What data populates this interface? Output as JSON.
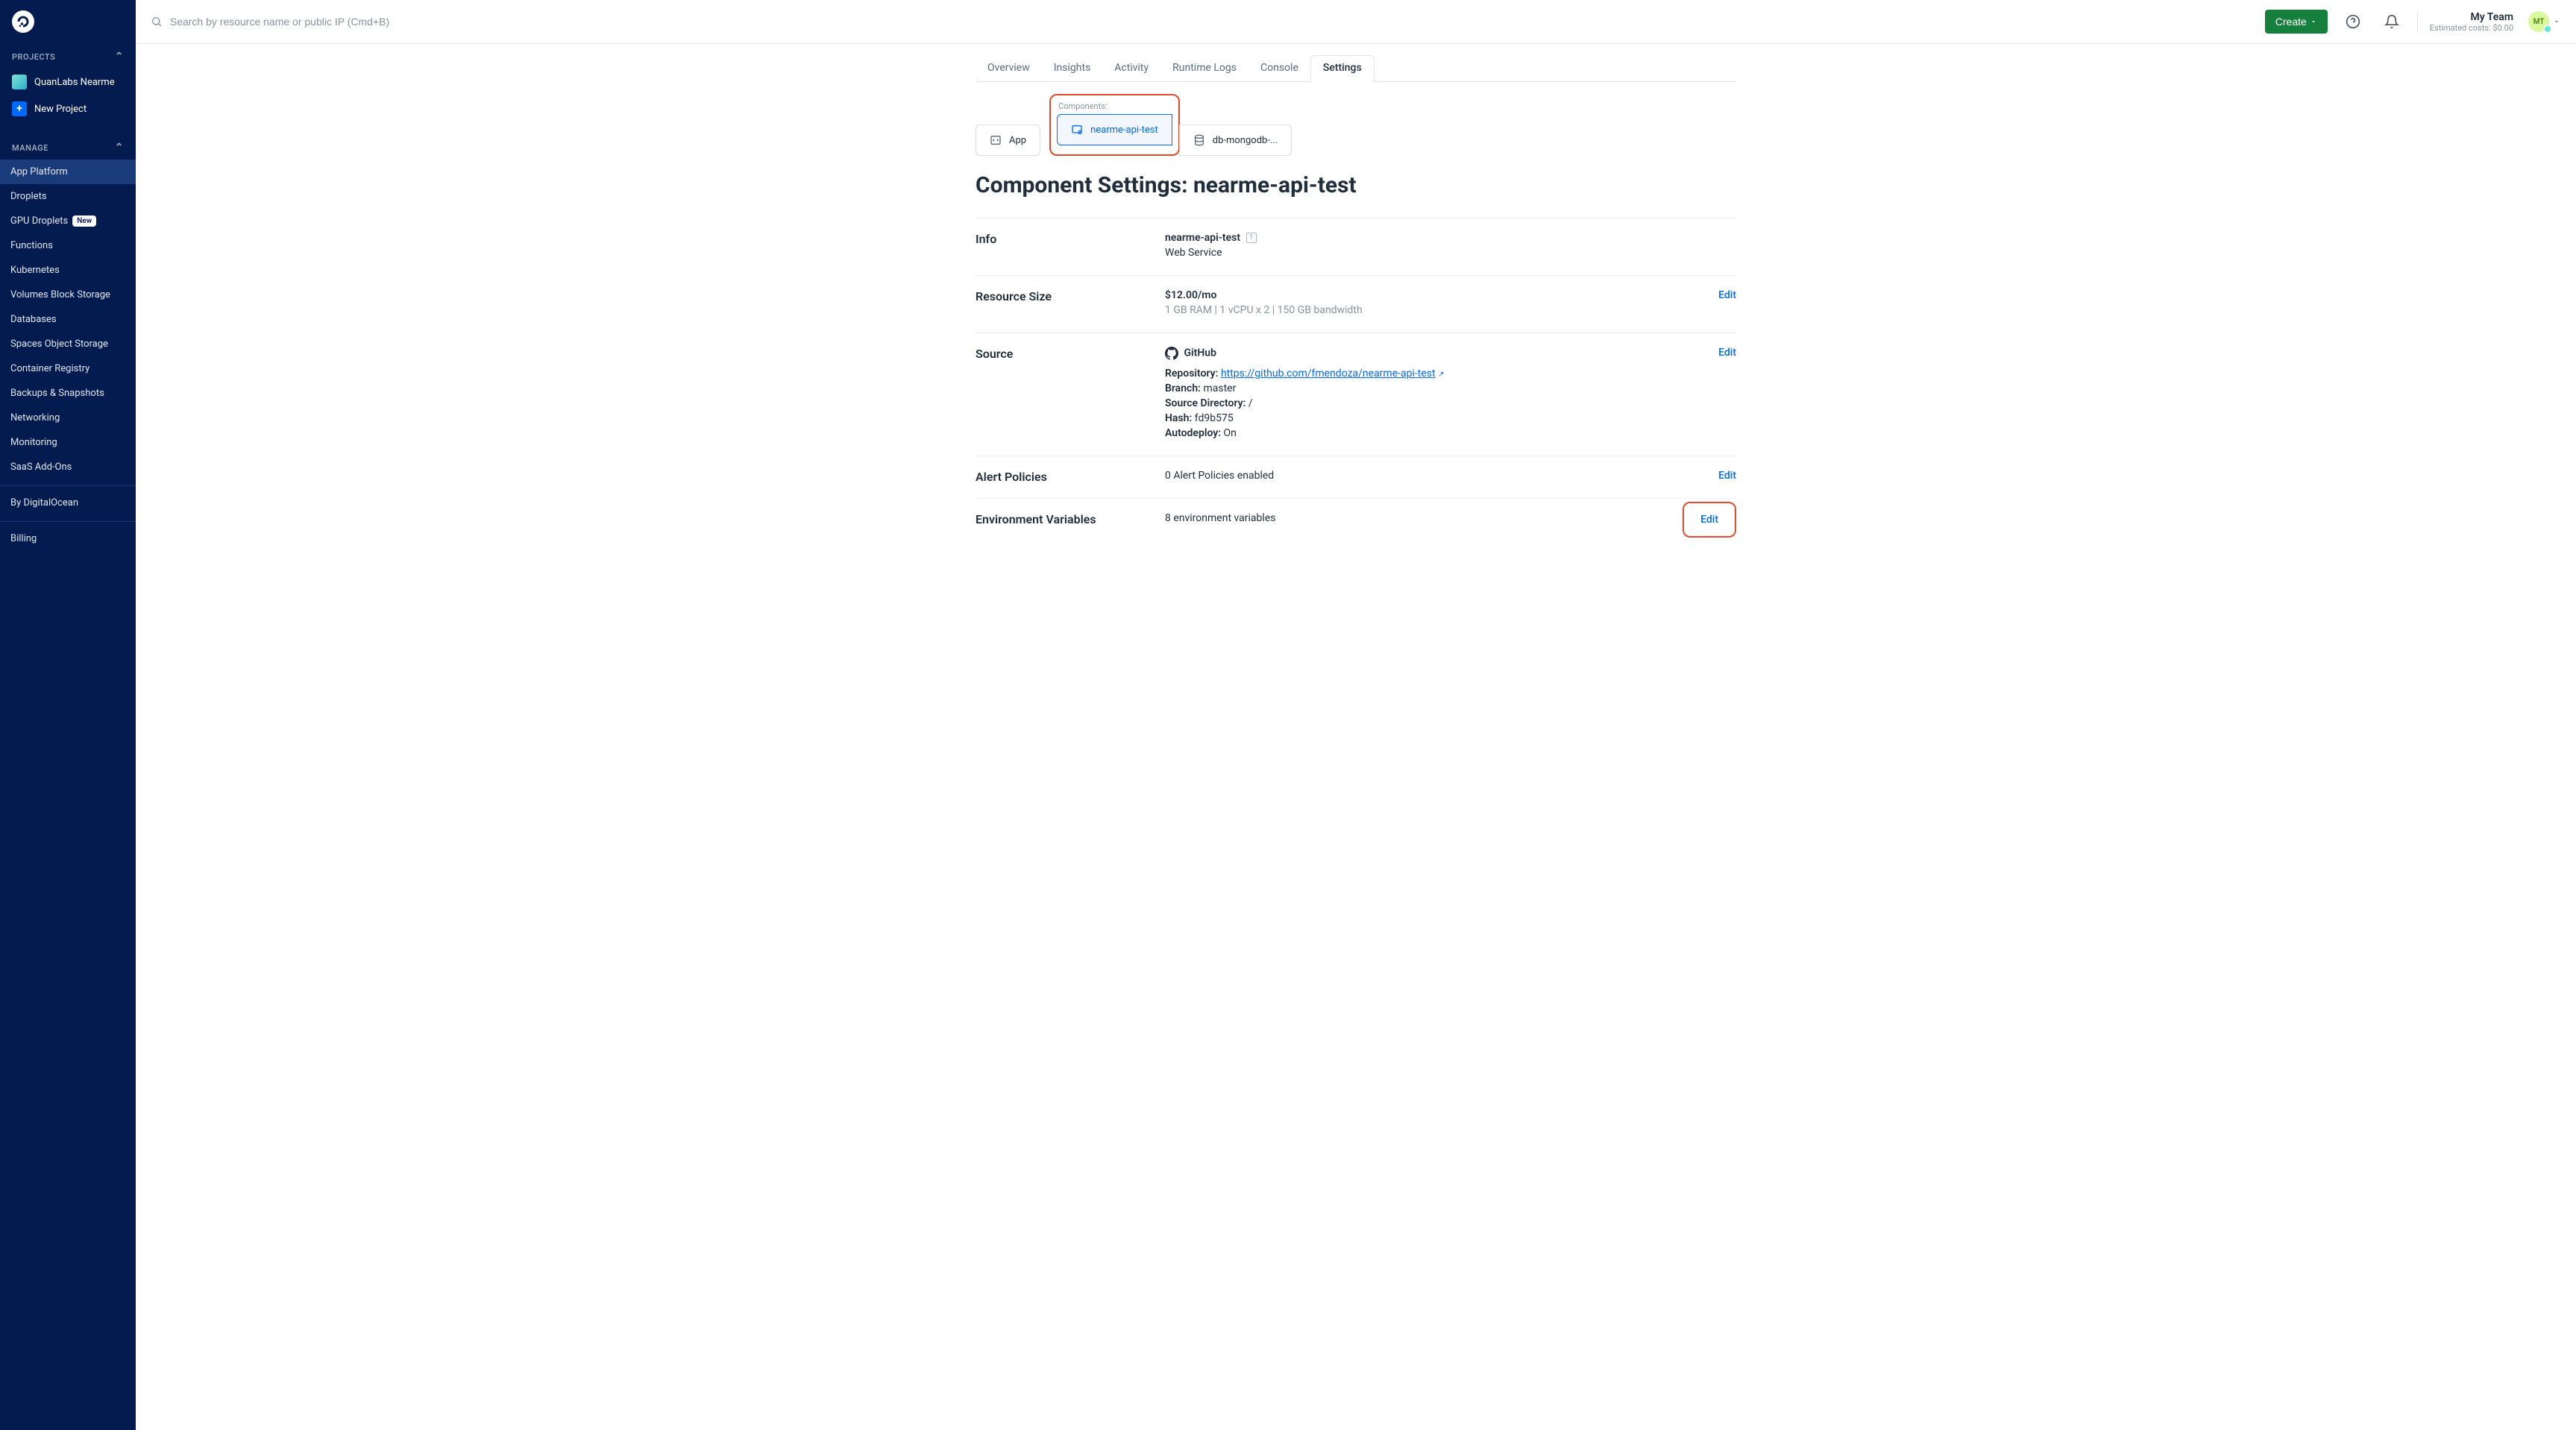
{
  "sidebar": {
    "sections": {
      "projects_label": "PROJECTS",
      "manage_label": "MANAGE"
    },
    "project_name": "QuanLabs Nearme",
    "new_project_label": "New Project",
    "manage_items": [
      {
        "label": "App Platform"
      },
      {
        "label": "Droplets"
      },
      {
        "label": "GPU Droplets",
        "badge": "New"
      },
      {
        "label": "Functions"
      },
      {
        "label": "Kubernetes"
      },
      {
        "label": "Volumes Block Storage"
      },
      {
        "label": "Databases"
      },
      {
        "label": "Spaces Object Storage"
      },
      {
        "label": "Container Registry"
      },
      {
        "label": "Backups & Snapshots"
      },
      {
        "label": "Networking"
      },
      {
        "label": "Monitoring"
      },
      {
        "label": "SaaS Add-Ons"
      }
    ],
    "by_label": "By DigitalOcean",
    "billing_label": "Billing"
  },
  "header": {
    "search_placeholder": "Search by resource name or public IP (Cmd+B)",
    "create_label": "Create",
    "team_name": "My Team",
    "costs_label": "Estimated costs: $0.00",
    "avatar_initials": "MT"
  },
  "tabs": [
    {
      "label": "Overview"
    },
    {
      "label": "Insights"
    },
    {
      "label": "Activity"
    },
    {
      "label": "Runtime Logs"
    },
    {
      "label": "Console"
    },
    {
      "label": "Settings",
      "active": true
    }
  ],
  "selectors": {
    "app_label": "App",
    "components_label": "Components:",
    "component1_label": "nearme-api-test",
    "component2_label": "db-mongodb-..."
  },
  "page_title": "Component Settings: nearme-api-test",
  "sections": {
    "info": {
      "label": "Info",
      "name": "nearme-api-test",
      "type": "Web Service"
    },
    "resource_size": {
      "label": "Resource Size",
      "price": "$12.00/mo",
      "spec": "1 GB RAM | 1 vCPU x 2 | 150 GB bandwidth",
      "edit": "Edit"
    },
    "source": {
      "label": "Source",
      "provider": "GitHub",
      "repo_label": "Repository:",
      "repo_url": "https://github.com/fmendoza/nearme-api-test",
      "branch_label": "Branch:",
      "branch_value": "master",
      "srcdir_label": "Source Directory:",
      "srcdir_value": "/",
      "hash_label": "Hash:",
      "hash_value": "fd9b575",
      "autodeploy_label": "Autodeploy:",
      "autodeploy_value": "On",
      "edit": "Edit"
    },
    "alert": {
      "label": "Alert Policies",
      "value": "0 Alert Policies enabled",
      "edit": "Edit"
    },
    "env": {
      "label": "Environment Variables",
      "value": "8 environment variables",
      "edit": "Edit"
    }
  }
}
